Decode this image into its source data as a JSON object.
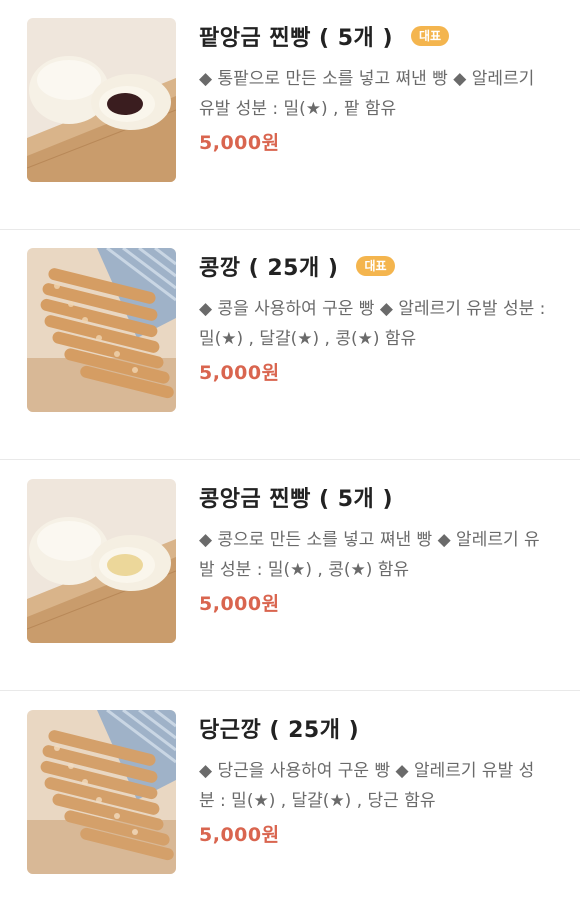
{
  "items": [
    {
      "title": "팥앙금 찐빵 ( 5개 )",
      "badge": "대표",
      "description": "◆ 통팥으로 만든 소를 넣고 쪄낸 빵 ◆ 알레르기 유발 성분 : 밀(★) , 팥 함유",
      "price": "5,000원",
      "image": "steamed-bun-red-bean"
    },
    {
      "title": "콩깡 ( 25개 )",
      "badge": "대표",
      "description": "◆ 콩을 사용하여 구운 빵 ◆ 알레르기 유발 성분 : 밀(★) , 달걀(★) , 콩(★) 함유",
      "price": "5,000원",
      "image": "bean-stick-cookies"
    },
    {
      "title": "콩앙금 찐빵 ( 5개 )",
      "badge": "",
      "description": "◆ 콩으로 만든 소를 넣고 쪄낸 빵 ◆ 알레르기 유발 성분 : 밀(★) , 콩(★) 함유",
      "price": "5,000원",
      "image": "steamed-bun-white-bean"
    },
    {
      "title": "당근깡 ( 25개 )",
      "badge": "",
      "description": "◆ 당근을 사용하여 구운 빵 ◆ 알레르기 유발 성분 : 밀(★) , 달걀(★) , 당근 함유",
      "price": "5,000원",
      "image": "carrot-stick-cookies"
    }
  ]
}
